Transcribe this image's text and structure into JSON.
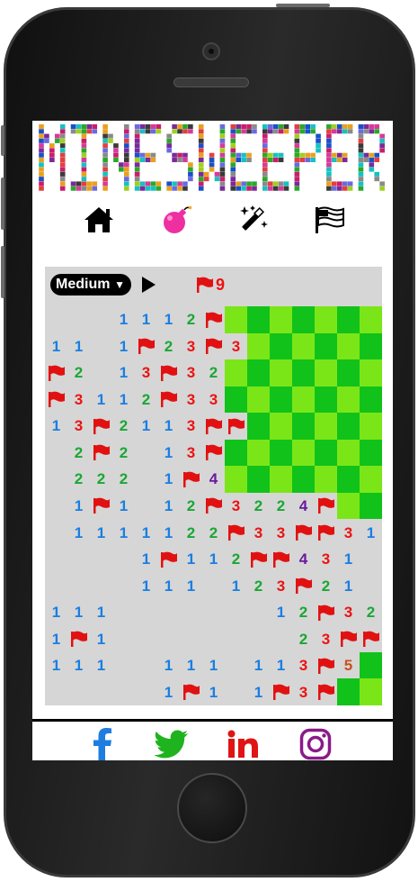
{
  "logo_text": "MINESWEEPER",
  "nav": [
    {
      "name": "nav-home",
      "icon": "home-icon"
    },
    {
      "name": "nav-game",
      "icon": "bomb-icon"
    },
    {
      "name": "nav-magic",
      "icon": "magic-wand-icon"
    },
    {
      "name": "nav-flag",
      "icon": "flag-icon"
    }
  ],
  "colors": {
    "bomb_accent": "#ee2fa0",
    "grass_light": "#7be617",
    "grass_dark": "#11c21a",
    "revealed": "#d6d6d6",
    "flag": "#e11111"
  },
  "game": {
    "difficulty": "Medium",
    "difficulty_options": [
      "Medium"
    ],
    "flags_remaining": "9"
  },
  "board": {
    "rows": 15,
    "cols": 15,
    "grid": [
      [
        ".",
        ".",
        ".",
        "1",
        "1",
        "1",
        "2",
        "F",
        "H",
        "H",
        "H",
        "H",
        "H",
        "H",
        "H"
      ],
      [
        "1",
        "1",
        ".",
        "1",
        "F",
        "2",
        "3",
        "F",
        "3",
        "H",
        "H",
        "H",
        "H",
        "H",
        "H"
      ],
      [
        "F",
        "2",
        ".",
        "1",
        "3",
        "F",
        "3",
        "2",
        "H",
        "H",
        "H",
        "H",
        "H",
        "H",
        "H"
      ],
      [
        "F",
        "3",
        "1",
        "1",
        "2",
        "F",
        "3",
        "3",
        "H",
        "H",
        "H",
        "H",
        "H",
        "H",
        "H"
      ],
      [
        "1",
        "3",
        "F",
        "2",
        "1",
        "1",
        "3",
        "F",
        "F",
        "H",
        "H",
        "H",
        "H",
        "H",
        "H"
      ],
      [
        ".",
        "2",
        "F",
        "2",
        ".",
        "1",
        "3",
        "F",
        "H",
        "H",
        "H",
        "H",
        "H",
        "H",
        "H"
      ],
      [
        ".",
        "2",
        "2",
        "2",
        ".",
        "1",
        "F",
        "4",
        "H",
        "H",
        "H",
        "H",
        "H",
        "H",
        "H"
      ],
      [
        ".",
        "1",
        "F",
        "1",
        ".",
        "1",
        "2",
        "F",
        "3",
        "2",
        "2",
        "4",
        "F",
        "H",
        "H"
      ],
      [
        ".",
        "1",
        "1",
        "1",
        "1",
        "1",
        "2",
        "2",
        "F",
        "3",
        "3",
        "F",
        "F",
        "3",
        "1"
      ],
      [
        ".",
        ".",
        ".",
        ".",
        "1",
        "F",
        "1",
        "1",
        "2",
        "F",
        "F",
        "4",
        "3",
        "1",
        "."
      ],
      [
        ".",
        ".",
        ".",
        ".",
        "1",
        "1",
        "1",
        ".",
        "1",
        "2",
        "3",
        "F",
        "2",
        "1",
        "."
      ],
      [
        "1",
        "1",
        "1",
        ".",
        ".",
        ".",
        ".",
        ".",
        ".",
        ".",
        "1",
        "2",
        "F",
        "3",
        "2"
      ],
      [
        "1",
        "F",
        "1",
        ".",
        ".",
        ".",
        ".",
        ".",
        ".",
        ".",
        ".",
        "2",
        "3",
        "F",
        "F"
      ],
      [
        "1",
        "1",
        "1",
        ".",
        ".",
        "1",
        "1",
        "1",
        ".",
        "1",
        "1",
        "3",
        "F",
        "5",
        "H"
      ],
      [
        ".",
        ".",
        ".",
        ".",
        ".",
        "1",
        "F",
        "1",
        ".",
        "1",
        "F",
        "3",
        "F",
        "H",
        "H"
      ]
    ]
  },
  "social": [
    {
      "name": "facebook-link",
      "icon": "facebook-icon",
      "glyph": "f",
      "color": "#1e7de0"
    },
    {
      "name": "twitter-link",
      "icon": "twitter-icon",
      "glyph": "",
      "color": "#1fb41f"
    },
    {
      "name": "linkedin-link",
      "icon": "linkedin-icon",
      "glyph": "in",
      "color": "#e01414"
    },
    {
      "name": "instagram-link",
      "icon": "instagram-icon",
      "glyph": "",
      "color": "#8a1a8a"
    }
  ]
}
